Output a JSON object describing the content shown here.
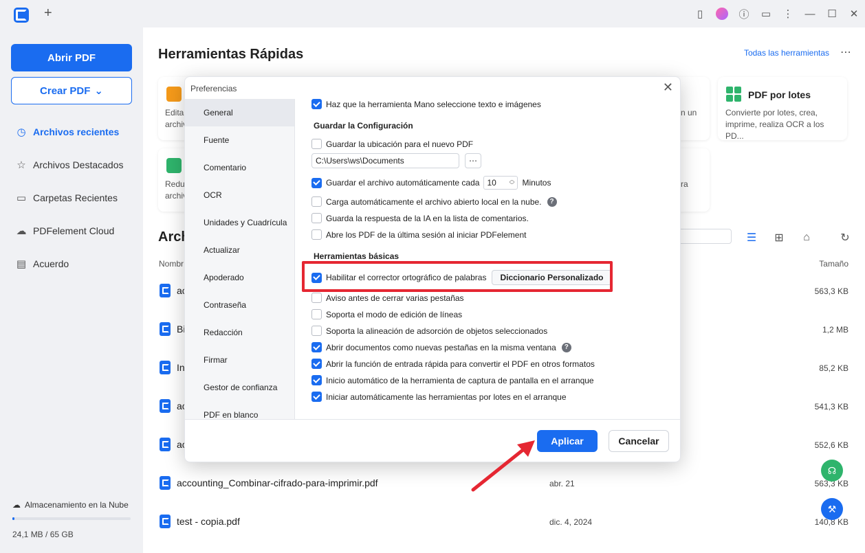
{
  "titlebar": {
    "new_tab": "+"
  },
  "sidebar": {
    "open_pdf": "Abrir PDF",
    "create_pdf": "Crear PDF",
    "create_chevron": "⌄",
    "items": [
      {
        "label": "Archivos recientes",
        "icon": "clock-icon",
        "glyph": "◷"
      },
      {
        "label": "Archivos Destacados",
        "icon": "star-icon",
        "glyph": "☆"
      },
      {
        "label": "Carpetas Recientes",
        "icon": "folder-icon",
        "glyph": "▭"
      },
      {
        "label": "PDFelement Cloud",
        "icon": "cloud-icon",
        "glyph": "☁"
      },
      {
        "label": "Acuerdo",
        "icon": "document-icon",
        "glyph": "▤"
      }
    ],
    "storage_label": "Almacenamiento en la Nube",
    "storage_size": "24,1 MB / 65 GB",
    "storage_fraction": 0.01
  },
  "main": {
    "title": "Herramientas Rápidas",
    "all_tools": "Todas las herramientas",
    "more": "⋯",
    "card_batch": {
      "title": "PDF por lotes",
      "desc": "Convierte por lotes, crea, imprime, realiza OCR a los PD..."
    },
    "card_stub_1": "Edita\narchiv",
    "card_stub_2": "Reduc\narchiv",
    "card_stub_3": "n un",
    "card_stub_4": "ra",
    "archive_title": "Arch",
    "col_name": "Nombr",
    "col_size": "Tamaño",
    "files": [
      {
        "name": "ac",
        "date": "",
        "size": "563,3 KB",
        "cloud": true
      },
      {
        "name": "Bi",
        "date": "",
        "size": "1,2 MB",
        "cloud": true
      },
      {
        "name": "In",
        "date": "",
        "size": "85,2 KB",
        "cloud": false
      },
      {
        "name": "ac",
        "date": "",
        "size": "541,3 KB",
        "cloud": false
      },
      {
        "name": "ac",
        "date": "",
        "size": "552,6 KB",
        "cloud": false
      },
      {
        "name": "accounting_Combinar-cifrado-para-imprimir.pdf",
        "date": "abr. 21",
        "size": "563,3 KB",
        "cloud": false
      },
      {
        "name": "test - copia.pdf",
        "date": "dic. 4, 2024",
        "size": "140,8 KB",
        "cloud": false
      }
    ]
  },
  "dialog": {
    "title": "Preferencias",
    "close": "✕",
    "side_items": [
      "General",
      "Fuente",
      "Comentario",
      "OCR",
      "Unidades y Cuadrícula",
      "Actualizar",
      "Apoderado",
      "Contraseña",
      "Redacción",
      "Firmar",
      "Gestor de confianza",
      "PDF en blanco"
    ],
    "opt_hand": "Haz que la herramienta Mano seleccione texto e imágenes",
    "sec_save": "Guardar la Configuración",
    "opt_save_location": "Guardar la ubicación para el nuevo PDF",
    "path_value": "C:\\Users\\ws\\Documents",
    "path_btn": "⋯",
    "opt_autosave": "Guardar el archivo automáticamente cada",
    "autosave_value": "10",
    "autosave_unit": "Minutos",
    "opt_cloud_load": "Carga automáticamente el archivo abierto local en la nube.",
    "opt_ai_reply": "Guarda la respuesta de la IA en la lista de comentarios.",
    "opt_last_session": "Abre los PDF de la última sesión al iniciar PDFelement",
    "sec_basic": "Herramientas básicas",
    "opt_spellcheck": "Habilitar el corrector ortográfico de palabras",
    "dict_btn": "Diccionario Personalizado",
    "opt_warn_close": "Aviso antes de cerrar varias pestañas",
    "opt_line_edit": "Soporta el modo de edición de líneas",
    "opt_snap": "Soporta la alineación de adsorción de objetos seleccionados",
    "opt_new_tabs": "Abrir documentos como nuevas pestañas en la misma ventana",
    "opt_quick_entry": "Abrir la función de entrada rápida para convertir el PDF en otros formatos",
    "opt_capture": "Inicio automático de la herramienta de captura de pantalla en el arranque",
    "opt_batch": "Iniciar automáticamente las herramientas por lotes en el arranque",
    "apply": "Aplicar",
    "cancel": "Cancelar",
    "help": "?"
  },
  "colors": {
    "accent": "#1a6cf0",
    "highlight": "#e52732",
    "fab_green": "#2fb46c"
  }
}
